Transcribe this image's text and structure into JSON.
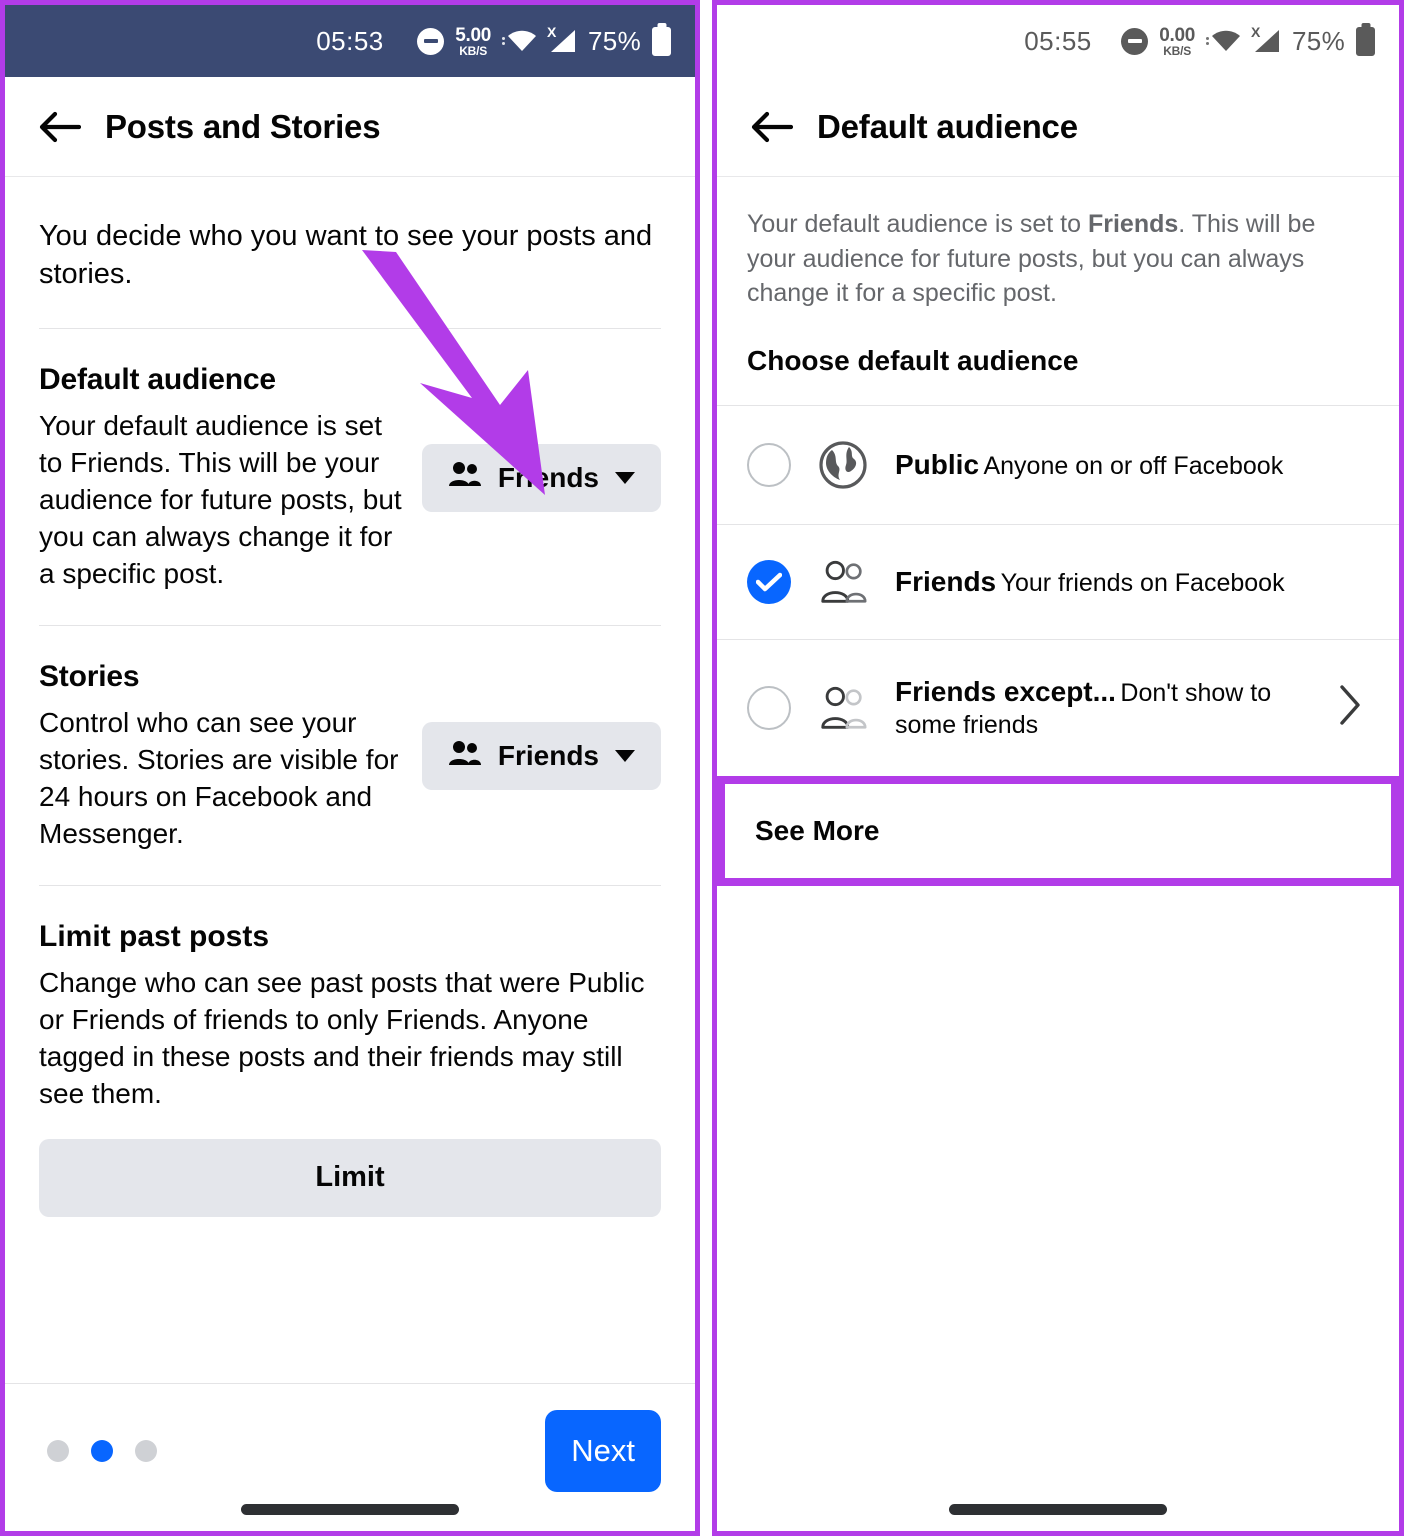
{
  "left_panel": {
    "status_bar": {
      "time": "05:53",
      "dnd_icon": "do-not-disturb-icon",
      "data_rate_value": "5.00",
      "data_rate_unit": "KB/S",
      "wifi_icon": "wifi-icon",
      "signal_icon": "signal-no-sim-icon",
      "signal_badge": "X",
      "battery_percent": "75%",
      "battery_icon": "battery-icon",
      "background_color": "#3b4a73"
    },
    "app_bar": {
      "back_icon": "back-arrow-icon",
      "title": "Posts and Stories"
    },
    "intro": "You decide who you want to see your posts and stories.",
    "sections": [
      {
        "heading": "Default audience",
        "body": "Your default audience is set to Friends. This will be your audience for future posts, but you can always change it for a specific post.",
        "control_label": "Friends",
        "control_icon": "friends-people-icon",
        "control_caret": "chevron-down-icon"
      },
      {
        "heading": "Stories",
        "body": "Control who can see your stories. Stories are visible for 24 hours on Facebook and Messenger.",
        "control_label": "Friends",
        "control_icon": "friends-people-icon",
        "control_caret": "chevron-down-icon"
      }
    ],
    "limit_block": {
      "heading": "Limit past posts",
      "body": "Change who can see past posts that were Public or Friends of friends to only Friends. Anyone tagged in these posts and their friends may still see them.",
      "button_label": "Limit"
    },
    "footer": {
      "dots_total": 3,
      "dots_active_index": 1,
      "next_label": "Next",
      "next_color": "#0866ff"
    }
  },
  "right_panel": {
    "status_bar": {
      "time": "05:55",
      "dnd_icon": "do-not-disturb-icon",
      "data_rate_value": "0.00",
      "data_rate_unit": "KB/S",
      "wifi_icon": "wifi-icon",
      "signal_icon": "signal-no-sim-icon",
      "signal_badge": "X",
      "battery_percent": "75%",
      "battery_icon": "battery-icon",
      "background_color": "#ffffff"
    },
    "app_bar": {
      "back_icon": "back-arrow-icon",
      "title": "Default audience"
    },
    "description_prefix": "Your default audience is set to ",
    "description_bold": "Friends",
    "description_suffix": ". This will be your audience for future posts, but you can always change it for a specific post.",
    "choose_heading": "Choose default audience",
    "options": [
      {
        "title": "Public",
        "subtitle": "Anyone on or off Facebook",
        "icon": "globe-icon",
        "selected": false
      },
      {
        "title": "Friends",
        "subtitle": "Your friends on Facebook",
        "icon": "friends-outline-icon",
        "selected": true
      },
      {
        "title": "Friends except...",
        "subtitle": "Don't show to some friends",
        "icon": "friends-except-icon",
        "selected": false,
        "chevron": "chevron-right-icon"
      }
    ],
    "see_more_label": "See More"
  },
  "annotations": {
    "arrow_color": "#b23ce8",
    "highlight_color": "#b23ce8"
  }
}
